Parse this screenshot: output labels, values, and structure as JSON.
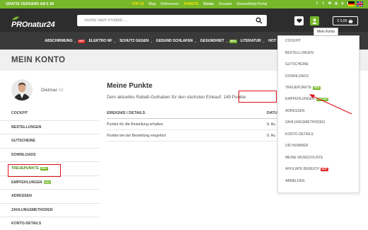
{
  "topbar": {
    "shipping": "GRATIS VERSAND AB € 80",
    "links": [
      "TOP 10",
      "Blog",
      "Referenzen",
      "PUNKTE",
      "Konto",
      "Versand",
      "Gesundheits-Portal"
    ]
  },
  "header": {
    "logo": "PROnatur24",
    "search_placeholder": "Suche nach Produkt ...",
    "cart_amount": "€ 0,00",
    "tooltip": "Mein Konto"
  },
  "nav": {
    "items": [
      {
        "label": "ABSCHIRMUNG",
        "badge": "HOT"
      },
      {
        "label": "ELEKTRO NF",
        "badge": ""
      },
      {
        "label": "SCHUTZ GEGEN",
        "badge": ""
      },
      {
        "label": "GESUND SCHLAFEN",
        "badge": ""
      },
      {
        "label": "GESUNDHEIT",
        "badge": "NEU"
      },
      {
        "label": "LITERATUR",
        "badge": ""
      },
      {
        "label": "HOT DEALS",
        "badge": ""
      }
    ]
  },
  "page": {
    "title": "MEIN KONTO"
  },
  "profile": {
    "name": "Dietmar",
    "number": "#1"
  },
  "sidebar": {
    "items": [
      {
        "label": "COCKPIT",
        "badge": ""
      },
      {
        "label": "BESTELLUNGEN",
        "badge": ""
      },
      {
        "label": "GUTSCHEINE",
        "badge": ""
      },
      {
        "label": "DOWNLOADS",
        "badge": ""
      },
      {
        "label": "TREUEPUNKTE",
        "badge": "NEU"
      },
      {
        "label": "EMPFEHLUNGEN",
        "badge": "NEU"
      },
      {
        "label": "ADRESSEN",
        "badge": ""
      },
      {
        "label": "ZAHLUNGSMETHODEN",
        "badge": ""
      },
      {
        "label": "KONTO-DETAILS",
        "badge": ""
      }
    ]
  },
  "main": {
    "title": "Meine Punkte",
    "desc_prefix": "Dein aktuelles Rabatt-Guthaben für den nächsten Einkauf: ",
    "points": "149 Punkte",
    "col_event": "EREIGNIS / DETAILS",
    "col_date": "DATU",
    "rows": [
      {
        "event": "Punkte für die Bestellung erhalten",
        "date": "9. Au"
      },
      {
        "event": "Punkte bei der Bestellung eingelöst",
        "date": "9. Au"
      }
    ]
  },
  "dropdown": {
    "items": [
      {
        "label": "COCKPIT",
        "badge": ""
      },
      {
        "label": "BESTELLUNGEN",
        "badge": ""
      },
      {
        "label": "GUTSCHEINE",
        "badge": ""
      },
      {
        "label": "DOWNLOADS",
        "badge": ""
      },
      {
        "label": "TREUEPUNKTE",
        "badge": "NEU"
      },
      {
        "label": "EMPFEHLUNGEN",
        "badge": "DELUXE"
      },
      {
        "label": "ADRESSEN",
        "badge": ""
      },
      {
        "label": "ZAHLUNGSMETHODEN",
        "badge": ""
      },
      {
        "label": "KONTO-DETAILS",
        "badge": ""
      },
      {
        "label": "UID NUMMER",
        "badge": ""
      },
      {
        "label": "MEINE WUNSCHLISTE",
        "badge": ""
      },
      {
        "label": "AFFILIATE BEREICH",
        "badge": "HOT"
      },
      {
        "label": "ABMELDEN",
        "badge": ""
      }
    ]
  },
  "colors": {
    "brand_green": "#76b82a",
    "header_dark": "#2d2d2d",
    "highlight_red": "#e0101a"
  }
}
